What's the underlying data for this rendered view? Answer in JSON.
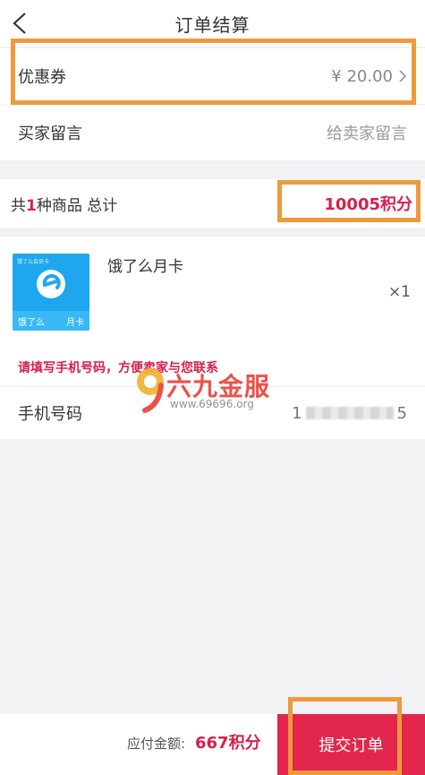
{
  "nav": {
    "title": "订单结算"
  },
  "coupon": {
    "label": "优惠券",
    "value": "¥ 20.00"
  },
  "message": {
    "label": "买家留言",
    "placeholder": "给卖家留言"
  },
  "summary": {
    "prefix": "共",
    "count": "1",
    "suffix": "种商品 总计",
    "total": "10005积分"
  },
  "product": {
    "name": "饿了么月卡",
    "quantity": "×1",
    "thumb_brand": "饿了么",
    "thumb_type": "月卡",
    "thumb_top": "饿了么会员卡"
  },
  "hint": "请填写手机号码，方便卖家与您联系",
  "phone": {
    "label": "手机号码",
    "first": "1",
    "last": "5"
  },
  "watermark": {
    "cn": "六九金服",
    "url": "www.69696.org"
  },
  "footer": {
    "pay_label": "应付金额:",
    "pay_value": "667积分",
    "submit_label": "提交订单"
  },
  "colors": {
    "accent": "#e3264b",
    "price": "#d6204b",
    "highlight": "#ee9a3b"
  }
}
